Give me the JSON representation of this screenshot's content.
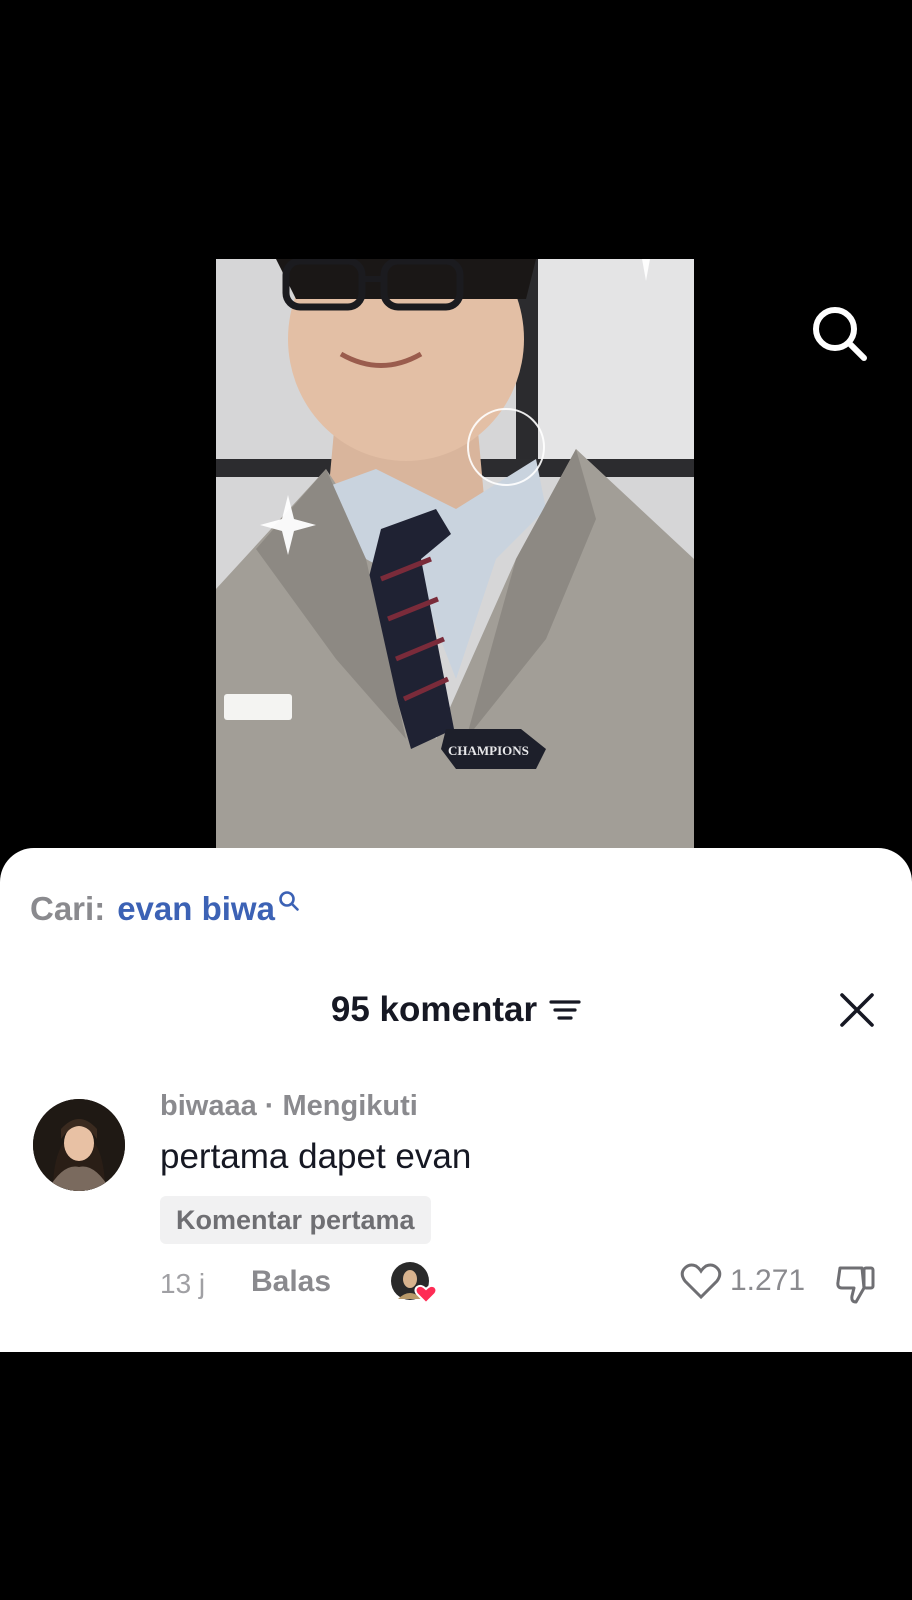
{
  "video": {
    "search_icon": "search-icon",
    "badge_text": "CHAMPIONS"
  },
  "search_suggestion": {
    "prefix": "Cari:",
    "query": "evan biwa",
    "icon": "search-icon"
  },
  "comments_header": {
    "title": "95 komentar",
    "sort_icon": "sort-icon",
    "close_icon": "close-icon"
  },
  "comment": {
    "meta": "biwaaa · Mengikuti",
    "text": "pertama dapet evan",
    "badge": "Komentar pertama",
    "time": "13 j",
    "reply_label": "Balas",
    "like_count": "1.271",
    "like_icon": "heart-outline-icon",
    "dislike_icon": "thumbs-down-icon"
  },
  "colors": {
    "accent_link": "#3c62b5",
    "like_red": "#fe2c55",
    "sheet_bg": "#ffffff"
  }
}
